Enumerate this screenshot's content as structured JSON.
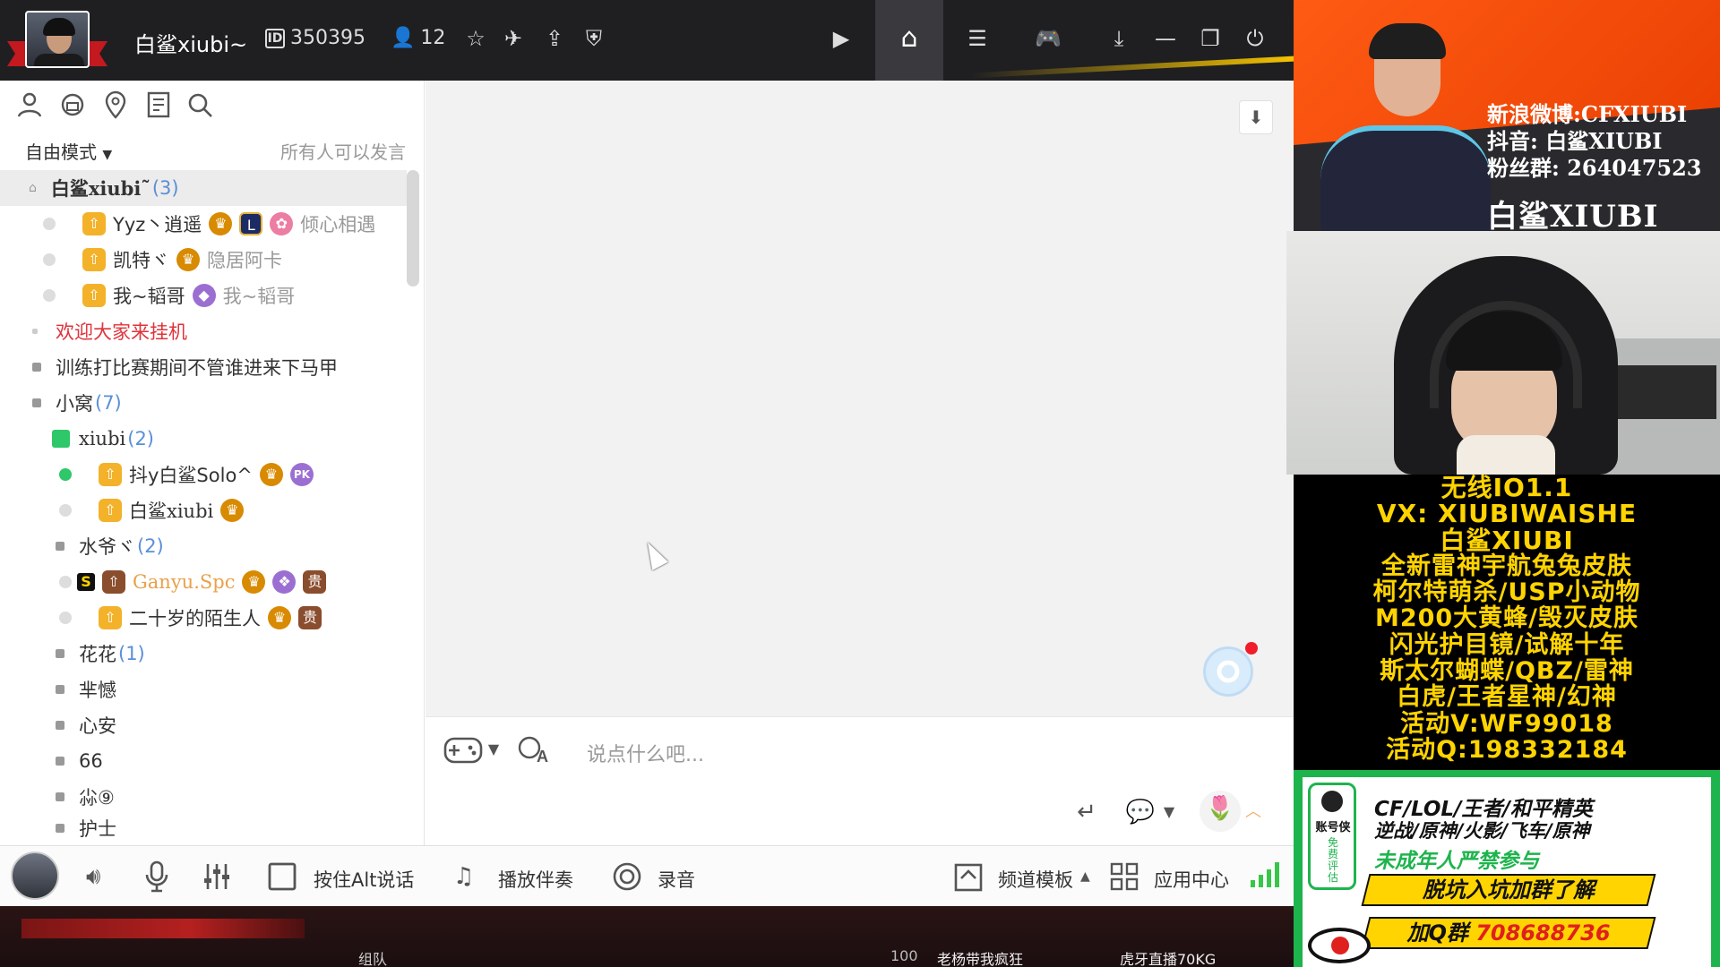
{
  "titlebar": {
    "user_name": "白鲨xiubi~",
    "id_value": "350395",
    "member_count": "12"
  },
  "left_panel": {
    "mode_label": "自由模式",
    "mode_hint": "所有人可以发言",
    "channel_root": {
      "name": "白鲨xiubi˜",
      "count": "(3)"
    },
    "root_members": [
      {
        "name": "Yyz丶逍遥",
        "tail": "倾心相遇"
      },
      {
        "name": "凯特ヾ",
        "tail": "隐居阿卡"
      },
      {
        "name": "我~韬哥",
        "tail": "我~韬哥"
      }
    ],
    "welcome_row": "欢迎大家来挂机",
    "notice_row": "训练打比赛期间不管谁进来下马甲",
    "sub_channel": {
      "name": "小窝",
      "count": "(7)"
    },
    "xiubi_channel": {
      "name": "xiubi",
      "count": "(2)"
    },
    "xiubi_members": [
      {
        "name": "抖y白鲨Solo^",
        "tail": "PK"
      },
      {
        "name": "白鲨xiubi",
        "tail": ""
      }
    ],
    "shuiye_channel": {
      "name": "水爷ヾ",
      "count": "(2)"
    },
    "shuiye_members": [
      {
        "name": "Ganyu.Spc",
        "tail": "贵"
      },
      {
        "name": "二十岁的陌生人",
        "tail": "贵"
      }
    ],
    "huahua_channel": {
      "name": "花花",
      "count": "(1)"
    },
    "other_channels": [
      "芈憾",
      "心安",
      "66",
      "尛⑨",
      "护士"
    ]
  },
  "chat": {
    "input_placeholder": "说点什么吧..."
  },
  "bottom_bar": {
    "push_to_talk": "按住Alt说话",
    "play_music": "播放伴奏",
    "record": "录音",
    "channel_template": "频道模板",
    "app_center": "应用中心"
  },
  "hud": {
    "team_label": "组队",
    "score": "100",
    "player1": "老杨带我疯狂",
    "player2": "虎牙直播70KG"
  },
  "overlay": {
    "weibo": "新浪微博:CFXIUBI",
    "douyin": "抖音:  白鲨XIUBI",
    "fans_group": "粉丝群:  264047523",
    "brand": "白鲨XIUBI",
    "promo_lines": [
      "无线IO1.1",
      "VX:  XIUBIWAISHE",
      "白鲨XIUBI",
      "全新雷神宇航兔兔皮肤",
      "柯尔特萌杀/USP小动物",
      "M200大黄蜂/毁灭皮肤",
      "闪光护目镜/试解十年",
      "斯太尔蝴蝶/QBZ/雷神",
      "白虎/王者星神/幻神",
      "活动V:WF99018",
      "活动Q:198332184"
    ],
    "green_ad": {
      "logo_word": "账号侠",
      "logo_tag": "免费评估",
      "line1": "CF/LOL/王者/和平精英",
      "line2": "逆战/原神/火影/飞车/原神",
      "line3": "未成年人严禁参与",
      "pill1": "脱坑入坑加群了解",
      "pill2_label": "加Q群",
      "pill2_number": "708688736"
    }
  },
  "colors": {
    "overlay_orange": "#ff5b14",
    "promo_yellow": "#ffd400",
    "ad_green": "#1eb44d",
    "online_green": "#2ec76a",
    "count_blue": "#5a8fd6",
    "welcome_red": "#e0333b"
  }
}
